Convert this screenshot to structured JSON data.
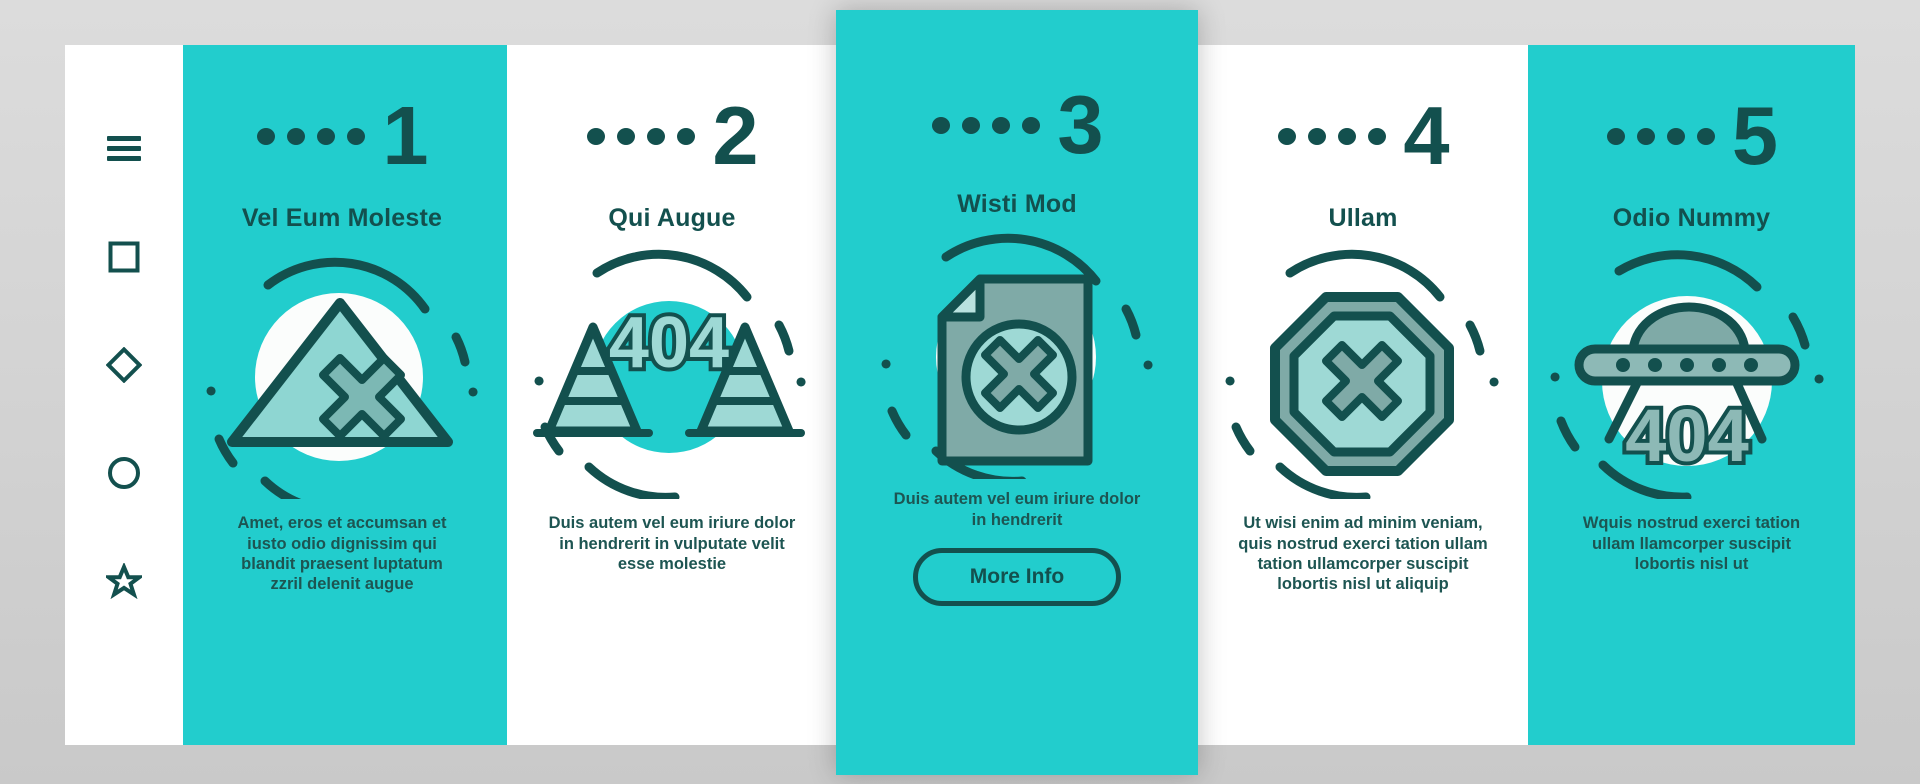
{
  "theme": {
    "accent_teal": "#22cdcd",
    "dark_green": "#13504e",
    "panel_white": "#ffffff",
    "background_gray": "#d0d0d0",
    "illustration_light": "#8ed6d2",
    "illustration_mid": "#7aa9a6"
  },
  "sidebar": {
    "items": [
      {
        "name": "menu-icon",
        "label": "hamburger-menu"
      },
      {
        "name": "square-icon",
        "label": "square"
      },
      {
        "name": "diamond-icon",
        "label": "diamond"
      },
      {
        "name": "circle-icon",
        "label": "circle"
      },
      {
        "name": "star-icon",
        "label": "star"
      }
    ]
  },
  "panels": [
    {
      "step": "1",
      "dots": 4,
      "title": "Vel Eum Moleste",
      "body": "Amet, eros et accumsan et iusto odio dignissim qui blandit praesent luptatum zzril delenit augue",
      "illustration": "warning-triangle-x-icon",
      "background": "teal",
      "featured": false,
      "button": null
    },
    {
      "step": "2",
      "dots": 4,
      "title": "Qui Augue",
      "body": "Duis autem vel eum iriure dolor in hendrerit in vulputate velit esse molestie",
      "illustration": "traffic-cones-404-icon",
      "illustration_label": "404",
      "background": "white",
      "featured": false,
      "button": null
    },
    {
      "step": "3",
      "dots": 4,
      "title": "Wisti Mod",
      "body": "Duis autem vel eum iriure dolor in hendrerit",
      "illustration": "document-error-x-icon",
      "background": "teal",
      "featured": true,
      "button": "More Info"
    },
    {
      "step": "4",
      "dots": 4,
      "title": "Ullam",
      "body": "Ut wisi enim ad minim veniam, quis nostrud exerci tation ullam tation ullamcorper suscipit lobortis nisl ut aliquip",
      "illustration": "octagon-stop-x-icon",
      "background": "white",
      "featured": false,
      "button": null
    },
    {
      "step": "5",
      "dots": 4,
      "title": "Odio Nummy",
      "body": "Wquis nostrud exerci tation ullam llamcorper suscipit lobortis nisl ut",
      "illustration": "ufo-404-icon",
      "illustration_label": "404",
      "background": "teal",
      "featured": false,
      "button": null
    }
  ]
}
